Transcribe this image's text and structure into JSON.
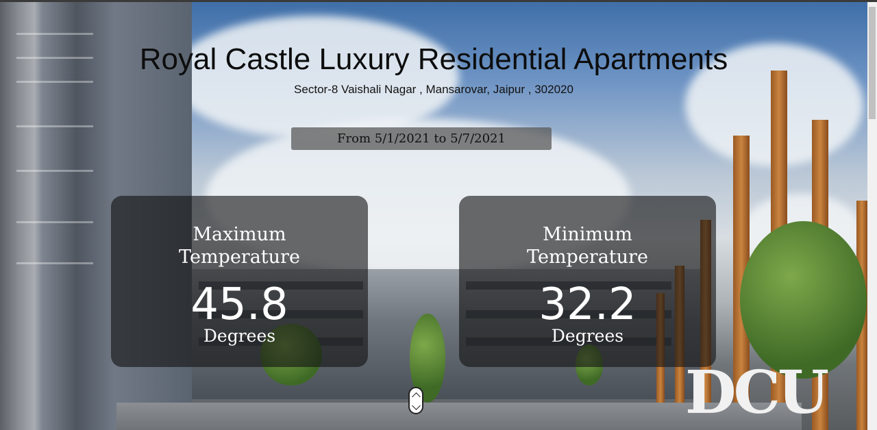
{
  "header": {
    "title": "Royal Castle Luxury Residential Apartments",
    "address": "Sector-8 Vaishali Nagar , Mansarovar, Jaipur , 302020",
    "date_range": "From 5/1/2021 to 5/7/2021"
  },
  "cards": {
    "max": {
      "label_line1": "Maximum",
      "label_line2": "Temperature",
      "value": "45.8",
      "unit": "Degrees"
    },
    "min": {
      "label_line1": "Minimum",
      "label_line2": "Temperature",
      "value": "32.2",
      "unit": "Degrees"
    }
  },
  "background": {
    "sign_text": "DCU"
  },
  "icons": {
    "scroll_button": "scroll-chevrons-icon"
  },
  "colors": {
    "card_bg": "#141414",
    "text_dark": "#0d0d0d",
    "text_light": "#ffffff"
  }
}
